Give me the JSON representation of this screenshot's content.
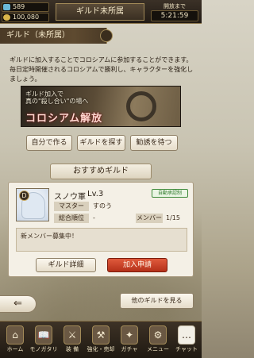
{
  "status": {
    "gems": "589",
    "gold": "100,080",
    "title": "ギルド未所属",
    "clock_label": "開放まで",
    "clock_value": "5:21:59"
  },
  "section": {
    "header": "ギルド（未所属）"
  },
  "intro": {
    "text": "ギルドに加入することでコロシアムに参加することができます。毎日定時開催されるコロシアムで勝利し、キャラクターを強化しましょう。"
  },
  "banner": {
    "line1": "ギルド加入で",
    "line2": "真の\"殺し合い\"の場へ",
    "main": "コロシアム解放"
  },
  "actions": {
    "create": "自分で作る",
    "search": "ギルドを探す",
    "wait": "勧誘を待つ"
  },
  "recommended": {
    "ribbon": "おすすめギルド",
    "guild": {
      "rank_badge": "D",
      "name": "スノウ軍",
      "level": "Lv.3",
      "auto_badge": "自動承認制",
      "master_label": "マスター",
      "master_value": "すのう",
      "rank_label": "総合順位",
      "rank_value": "-",
      "member_label": "メンバー",
      "member_value": "1/15",
      "message": "新メンバー募集中！",
      "detail_button": "ギルド詳細",
      "join_button": "加入申請"
    }
  },
  "navigation": {
    "back_symbol": "⇐",
    "other_guilds": "他のギルドを見る"
  },
  "bottom_nav": {
    "items": [
      {
        "label": "ホーム",
        "icon": "⌂"
      },
      {
        "label": "モノガタリ",
        "icon": "📖"
      },
      {
        "label": "装 備",
        "icon": "⚔"
      },
      {
        "label": "強化・売却",
        "icon": "⚒"
      },
      {
        "label": "ガチャ",
        "icon": "✦"
      },
      {
        "label": "メニュー",
        "icon": "⚙"
      },
      {
        "label": "チャット",
        "icon": "…"
      }
    ]
  }
}
